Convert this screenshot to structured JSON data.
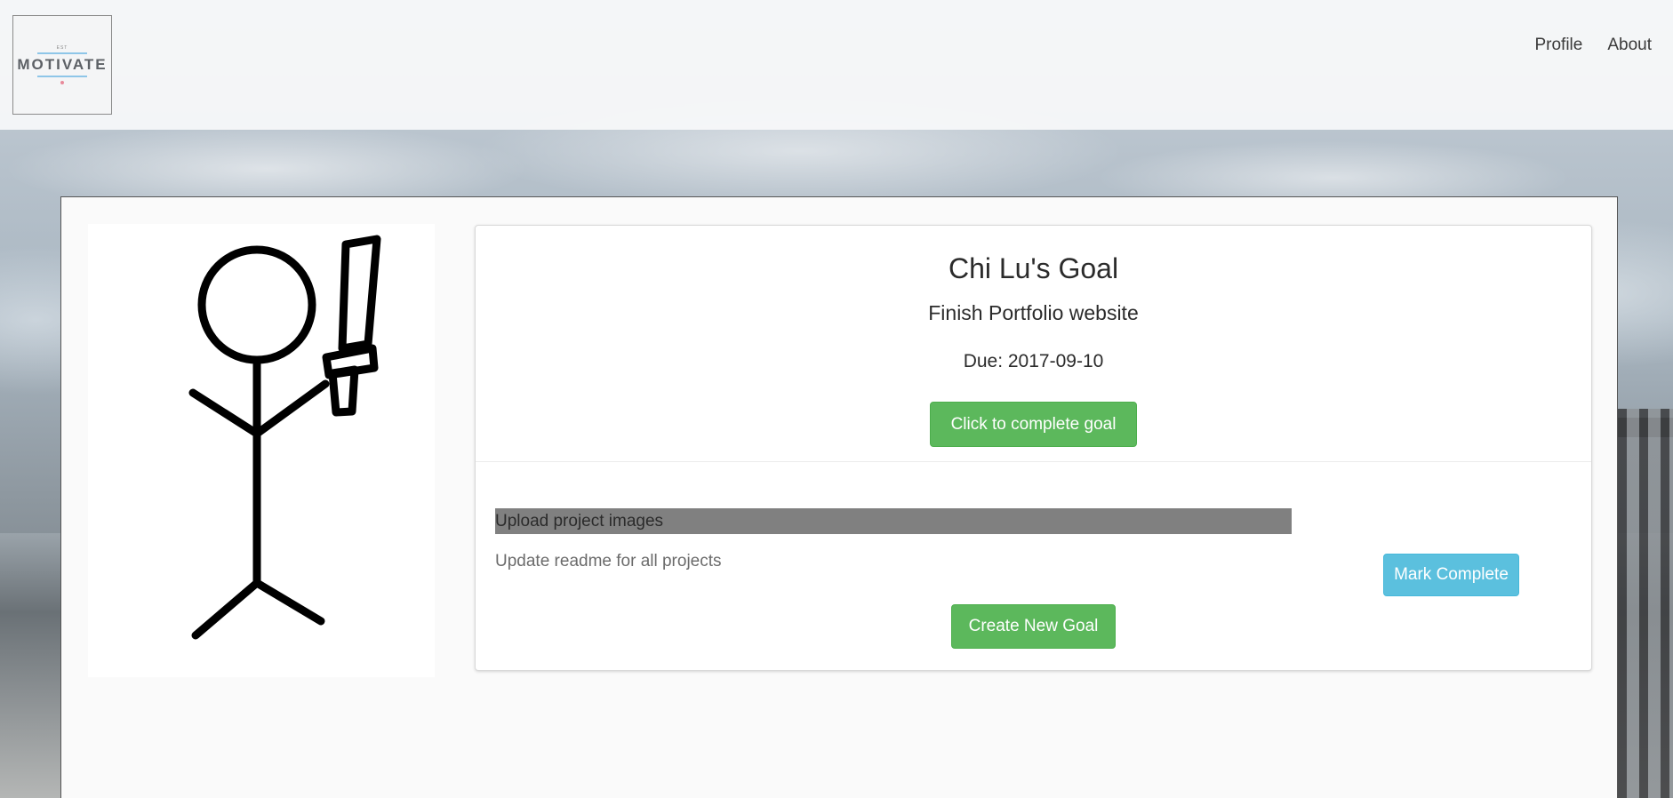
{
  "header": {
    "logo": {
      "small_text": "EST",
      "text": "MOTIVATE"
    },
    "nav": [
      {
        "label": "Profile"
      },
      {
        "label": "About"
      }
    ]
  },
  "goal": {
    "title": "Chi Lu's Goal",
    "description": "Finish Portfolio website",
    "due": "Due: 2017-09-10",
    "complete_button": "Click to complete goal"
  },
  "tasks": [
    {
      "label": "Upload project images",
      "selected": true
    },
    {
      "label": "Update readme for all projects",
      "selected": false
    }
  ],
  "mark_complete_button": "Mark Complete",
  "new_goal_button": "Create New Goal",
  "colors": {
    "primary_green": "#5cb85c",
    "info_blue": "#5bc0de",
    "selected_row": "#808080"
  }
}
